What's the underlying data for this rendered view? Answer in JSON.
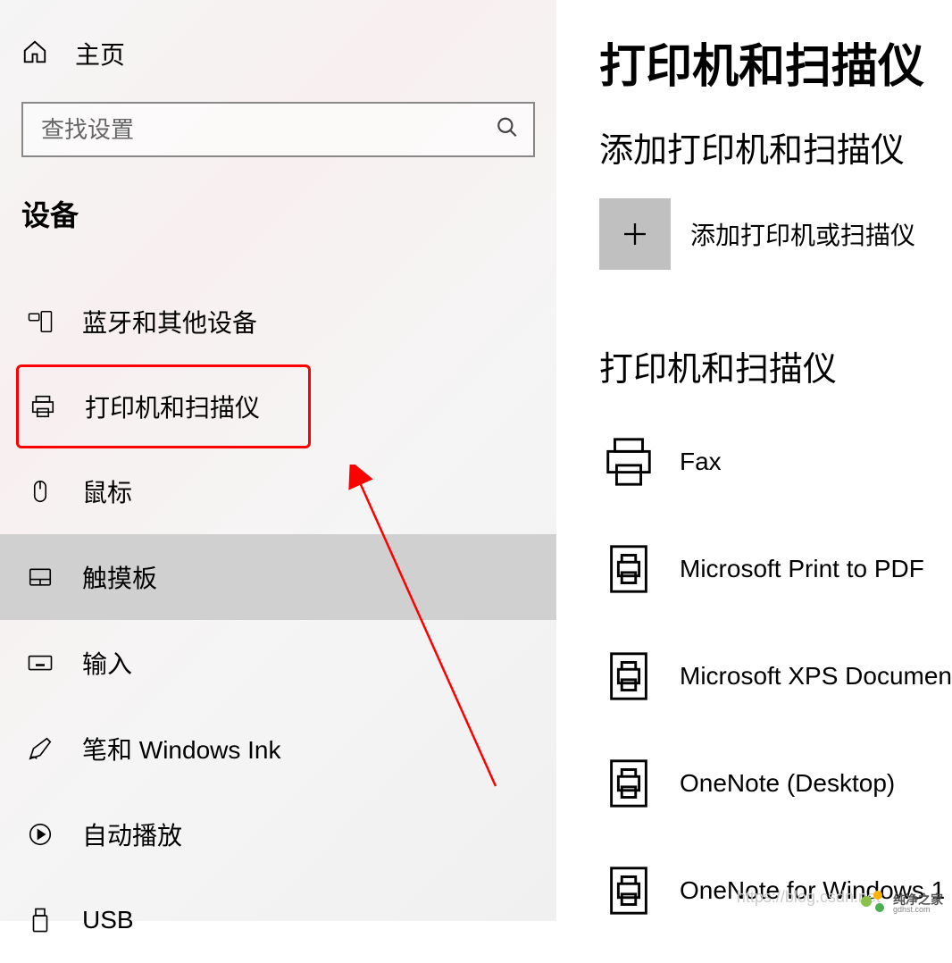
{
  "sidebar": {
    "home_label": "主页",
    "search_placeholder": "查找设置",
    "section_label": "设备",
    "items": [
      {
        "label": "蓝牙和其他设备",
        "icon": "bluetooth-devices-icon"
      },
      {
        "label": "打印机和扫描仪",
        "icon": "printer-icon"
      },
      {
        "label": "鼠标",
        "icon": "mouse-icon"
      },
      {
        "label": "触摸板",
        "icon": "touchpad-icon"
      },
      {
        "label": "输入",
        "icon": "keyboard-icon"
      },
      {
        "label": "笔和 Windows Ink",
        "icon": "pen-icon"
      },
      {
        "label": "自动播放",
        "icon": "autoplay-icon"
      },
      {
        "label": "USB",
        "icon": "usb-icon"
      }
    ]
  },
  "main": {
    "title": "打印机和扫描仪",
    "add_section_title": "添加打印机和扫描仪",
    "add_button_label": "添加打印机或扫描仪",
    "list_section_title": "打印机和扫描仪",
    "printers": [
      {
        "label": "Fax",
        "icon": "fax"
      },
      {
        "label": "Microsoft Print to PDF",
        "icon": "doc"
      },
      {
        "label": "Microsoft XPS Documen",
        "icon": "doc"
      },
      {
        "label": "OneNote (Desktop)",
        "icon": "doc"
      },
      {
        "label": "OneNote for Windows 1",
        "icon": "doc"
      }
    ]
  },
  "watermark": {
    "blog": "https://blog.csdn.net",
    "logo_cn": "纯净之家",
    "logo_en": "gdhst.com"
  },
  "annotation": {
    "highlighted_index": 1,
    "selected_index": 3,
    "highlight_color": "#ff0000"
  }
}
